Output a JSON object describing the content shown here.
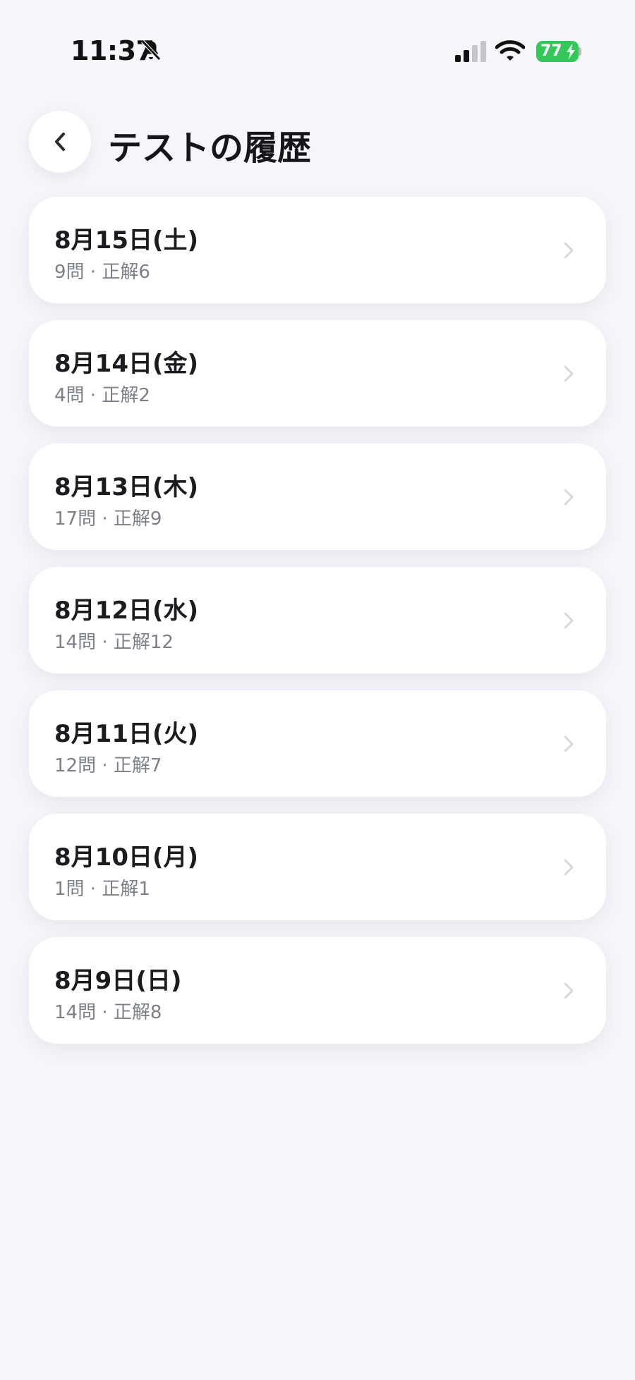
{
  "status_bar": {
    "time": "11:37",
    "battery": "77",
    "icons": [
      "bell-slash-icon",
      "cellular-signal-icon",
      "wifi-icon",
      "battery-charging-icon"
    ]
  },
  "header": {
    "back_icon": "chevron-left-icon",
    "title": "テストの履歴"
  },
  "colors": {
    "background": "#f5f6fa",
    "card": "#ffffff",
    "battery": "#34c759",
    "title": "#15161a",
    "secondary_text": "#7c8088",
    "chevron": "#d6d8de"
  },
  "history": {
    "items": [
      {
        "date": "8月15日(土)",
        "summary": "9問 · 正解6"
      },
      {
        "date": "8月14日(金)",
        "summary": "4問 · 正解2"
      },
      {
        "date": "8月13日(木)",
        "summary": "17問 · 正解9"
      },
      {
        "date": "8月12日(水)",
        "summary": "14問 · 正解12"
      },
      {
        "date": "8月11日(火)",
        "summary": "12問 · 正解7"
      },
      {
        "date": "8月10日(月)",
        "summary": "1問 · 正解1"
      },
      {
        "date": "8月9日(日)",
        "summary": "14問 · 正解8"
      }
    ]
  }
}
